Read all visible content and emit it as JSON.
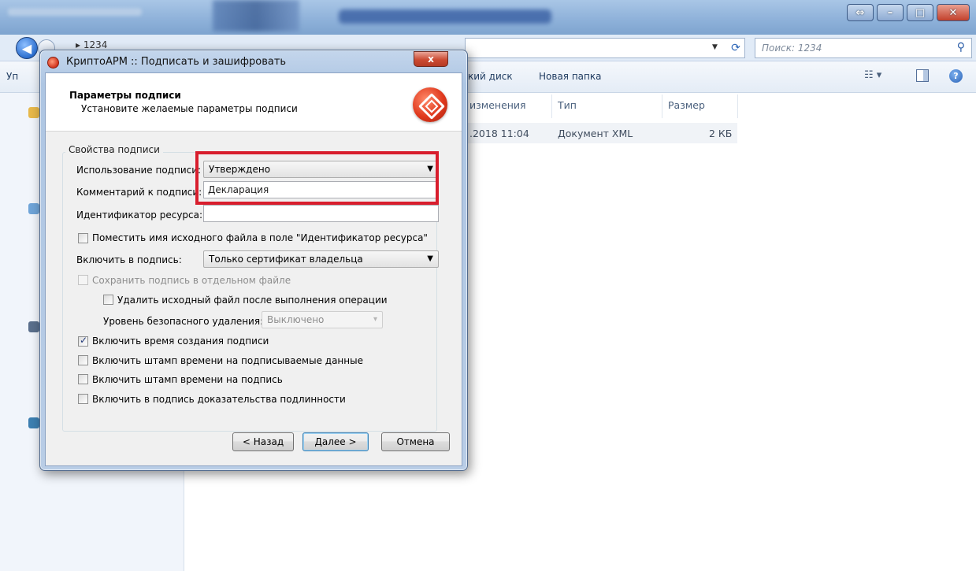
{
  "explorer": {
    "path": "▸ 1234",
    "search_placeholder": "Поиск: 1234",
    "toolbar": {
      "organize": "Уп",
      "disk": "кий диск",
      "new_folder": "Новая папка"
    },
    "columns": {
      "date": "изменения",
      "type": "Тип",
      "size": "Размер"
    },
    "file": {
      "date": ".2018 11:04",
      "type": "Документ XML",
      "size": "2 КБ"
    }
  },
  "dialog": {
    "title": "КриптоАРМ :: Подписать и зашифровать",
    "close": "x",
    "header_title": "Параметры подписи",
    "header_subtitle": "Установите желаемые параметры подписи",
    "group_label": "Свойства подписи",
    "usage_label": "Использование подписи:",
    "usage_value": "Утверждено",
    "comment_label": "Комментарий к подписи:",
    "comment_value": "Декларация",
    "resource_label": "Идентификатор ресурса:",
    "resource_value": "",
    "chk_filename": "Поместить имя исходного файла в поле \"Идентификатор ресурса\"",
    "include_label": "Включить в подпись:",
    "include_value": "Только сертификат владельца",
    "chk_separate": "Сохранить подпись в отдельном файле",
    "chk_delete": "Удалить исходный файл после выполнения операции",
    "secure_label": "Уровень безопасного удаления:",
    "secure_value": "Выключено",
    "chk_time": "Включить время создания подписи",
    "chk_stamp_data": "Включить штамп времени на подписываемые данные",
    "chk_stamp_sig": "Включить штамп времени на подпись",
    "chk_proof": "Включить в подпись доказательства подлинности",
    "btn_back": "< Назад",
    "btn_next": "Далее >",
    "btn_cancel": "Отмена"
  },
  "colors": {
    "highlight": "#d81e2d",
    "accent": "#3c7fb1"
  }
}
